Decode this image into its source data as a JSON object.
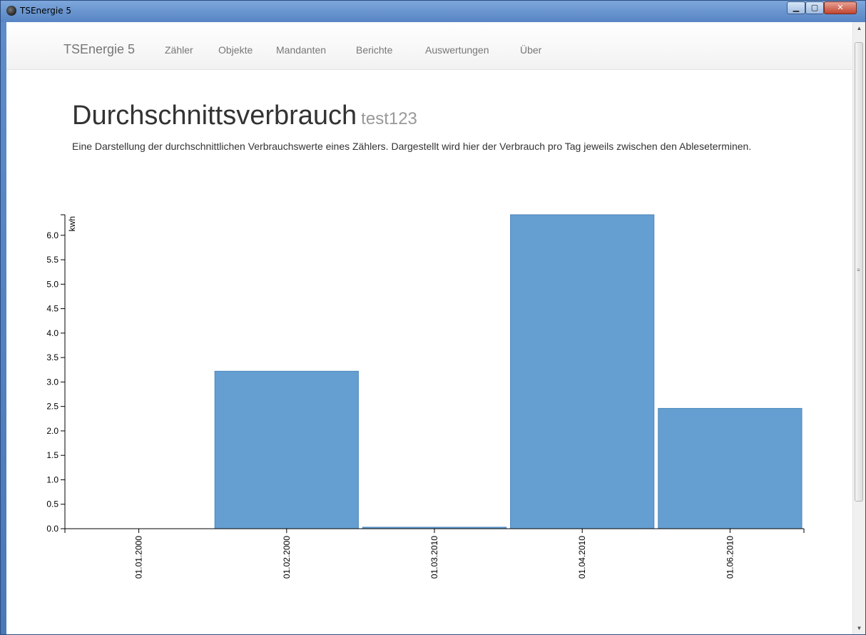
{
  "window": {
    "title": "TSEnergie 5"
  },
  "navbar": {
    "brand": "TSEnergie 5",
    "links": [
      "Zähler",
      "Objekte",
      "Mandanten",
      "Berichte",
      "Auswertungen",
      "Über"
    ]
  },
  "page": {
    "title": "Durchschnittsverbrauch",
    "subtitle": "test123",
    "description": "Eine Darstellung der durchschnittlichen Verbrauchswerte eines Zählers. Dargestellt wird hier der Verbrauch pro Tag jeweils zwischen den Ableseterminen."
  },
  "chart_data": {
    "type": "bar",
    "categories": [
      "01.01.2000",
      "01.02.2000",
      "01.03.2010",
      "01.04.2010",
      "01.06.2010"
    ],
    "values": [
      0,
      3.22,
      0.03,
      6.42,
      2.46
    ],
    "ylabel": "kwh",
    "ylim": [
      0,
      6.42
    ],
    "yticks": [
      "0.0",
      "0.5",
      "1.0",
      "1.5",
      "2.0",
      "2.5",
      "3.0",
      "3.5",
      "4.0",
      "4.5",
      "5.0",
      "5.5",
      "6.0"
    ],
    "bar_color": "#659fd1",
    "grid": false
  }
}
